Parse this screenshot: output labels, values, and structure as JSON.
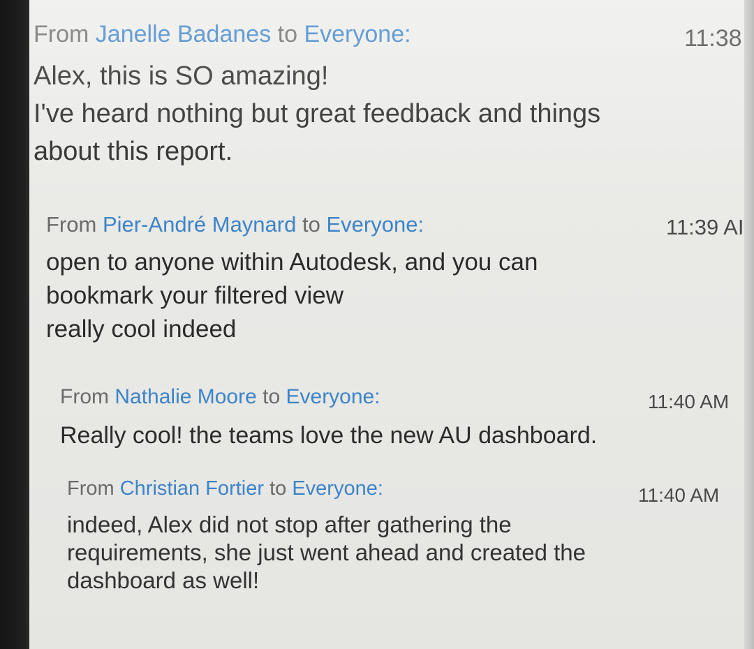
{
  "chat": {
    "messages": [
      {
        "from_label": "From",
        "sender": "Janelle Badanes",
        "to_label": "to",
        "recipient": "Everyone:",
        "time": "11:38",
        "lines": [
          "Alex, this is SO amazing!",
          "I've heard nothing but great feedback and things",
          "about this report."
        ]
      },
      {
        "from_label": "From",
        "sender": "Pier-André Maynard",
        "to_label": "to",
        "recipient": "Everyone:",
        "time": "11:39 AI",
        "lines": [
          "open to anyone within Autodesk, and you can",
          "bookmark your filtered view",
          "really cool indeed"
        ]
      },
      {
        "from_label": "From",
        "sender": "Nathalie Moore",
        "to_label": "to",
        "recipient": "Everyone:",
        "time": "11:40 AM",
        "lines": [
          "Really cool!  the teams love the new AU dashboard."
        ]
      },
      {
        "from_label": "From",
        "sender": "Christian Fortier",
        "to_label": "to",
        "recipient": "Everyone:",
        "time": "11:40 AM",
        "lines": [
          "indeed, Alex did not stop after gathering the",
          "requirements, she just went ahead and created the",
          "dashboard as well!"
        ]
      }
    ]
  },
  "colors": {
    "sender_blue": "#3d84c8",
    "header_gray": "#6b6b6b",
    "body_text": "#2b2b2b",
    "background": "#ececea"
  }
}
